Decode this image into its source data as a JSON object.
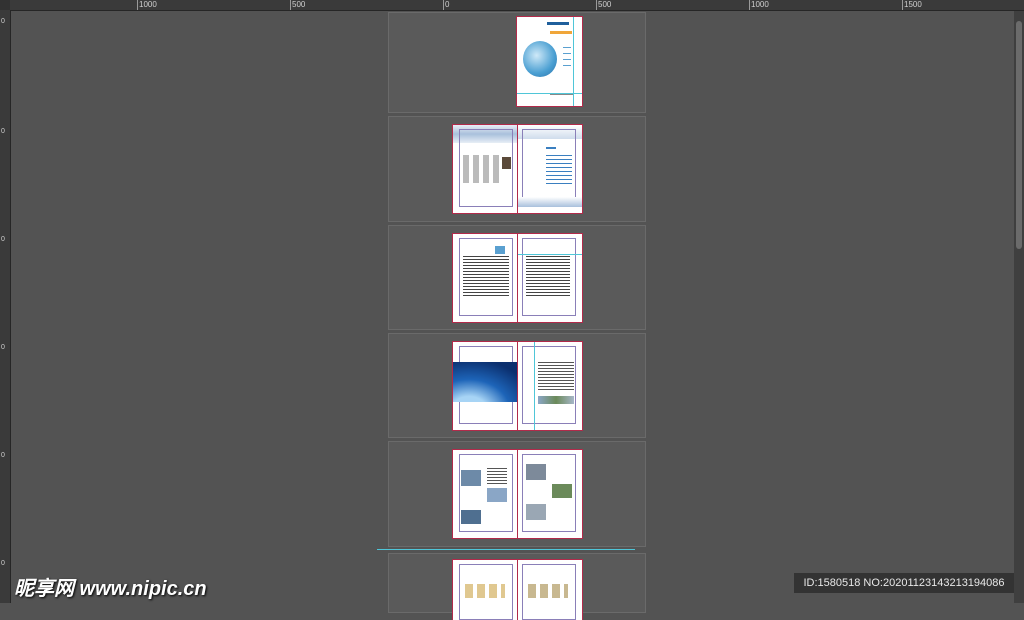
{
  "ruler": {
    "top_labels": [
      "1000",
      "500",
      "0",
      "500",
      "1000",
      "1500"
    ],
    "left_labels": [
      "0",
      "0",
      "0",
      "0",
      "0",
      "0"
    ]
  },
  "spreads": [
    {
      "name": "cover",
      "title": "Annual Report",
      "subtitle": "Company Overview"
    },
    {
      "name": "spread-2"
    },
    {
      "name": "spread-3"
    },
    {
      "name": "spread-4"
    },
    {
      "name": "spread-5"
    },
    {
      "name": "spread-6"
    }
  ],
  "watermark": {
    "site": "昵享网 www.nipic.cn",
    "id_text": "ID:1580518 NO:20201123143213194086"
  },
  "colors": {
    "background": "#535353",
    "page_border": "#b22a4a",
    "guide": "#4fc6d8"
  }
}
